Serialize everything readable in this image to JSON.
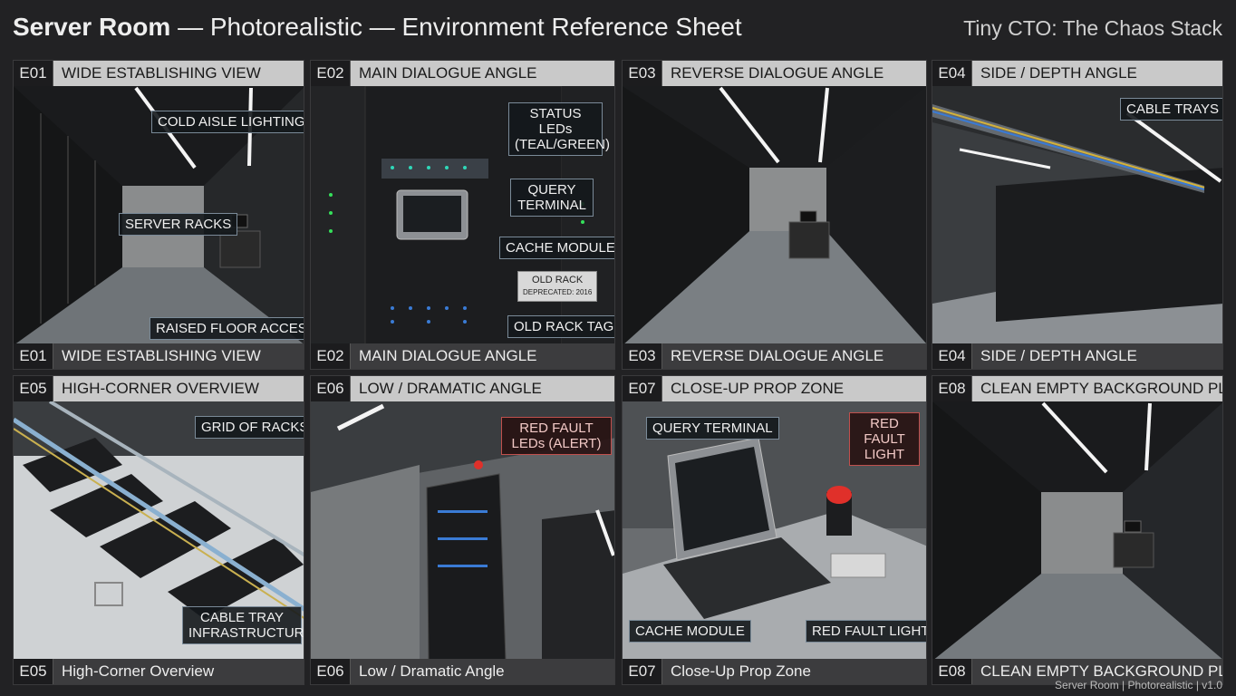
{
  "header": {
    "title_bold": "Server Room",
    "title_rest": " — Photorealistic — Environment Reference Sheet",
    "brand": "Tiny CTO: The Chaos Stack"
  },
  "panels": [
    {
      "code": "E01",
      "top_label": "WIDE ESTABLISHING VIEW",
      "bottom_label": "WIDE ESTABLISHING VIEW",
      "callouts": [
        "COLD AISLE LIGHTING",
        "SERVER RACKS",
        "RAISED FLOOR ACCESS"
      ]
    },
    {
      "code": "E02",
      "top_label": "MAIN DIALOGUE ANGLE",
      "bottom_label": "MAIN DIALOGUE ANGLE",
      "callouts": [
        "STATUS LEDs (TEAL/GREEN)",
        "QUERY TERMINAL",
        "CACHE MODULE",
        "OLD RACK TAG"
      ],
      "rack_tag": {
        "title": "OLD RACK",
        "sub": "DEPRECATED: 2016"
      }
    },
    {
      "code": "E03",
      "top_label": "REVERSE DIALOGUE ANGLE",
      "bottom_label": "REVERSE DIALOGUE ANGLE",
      "callouts": []
    },
    {
      "code": "E04",
      "top_label": "SIDE / DEPTH ANGLE",
      "bottom_label": "SIDE / DEPTH ANGLE",
      "callouts": [
        "CABLE TRAYS"
      ]
    },
    {
      "code": "E05",
      "top_label": "HIGH-CORNER OVERVIEW",
      "bottom_label": "High-Corner Overview",
      "callouts": [
        "GRID OF RACKS",
        "CABLE TRAY INFRASTRUCTURE"
      ]
    },
    {
      "code": "E06",
      "top_label": "LOW / DRAMATIC ANGLE",
      "bottom_label": "Low / Dramatic Angle",
      "callouts": [
        "RED FAULT LEDs (ALERT)"
      ]
    },
    {
      "code": "E07",
      "top_label": "CLOSE-UP PROP ZONE",
      "bottom_label": "Close-Up Prop Zone",
      "callouts": [
        "QUERY TERMINAL",
        "RED FAULT LIGHT",
        "CACHE MODULE",
        "RED FAULT LIGHT"
      ]
    },
    {
      "code": "E08",
      "top_label": "CLEAN EMPTY BACKGROUND PLATE",
      "bottom_label": "CLEAN EMPTY BACKGROUND PLATE",
      "callouts": []
    }
  ],
  "footer": "Server Room | Photorealistic | v1.0",
  "colors": {
    "background": "#222224",
    "callout_border": "#7a8a98",
    "alert_red": "#e0302a",
    "status_teal": "#2fd7b8",
    "status_green": "#35e05a"
  }
}
